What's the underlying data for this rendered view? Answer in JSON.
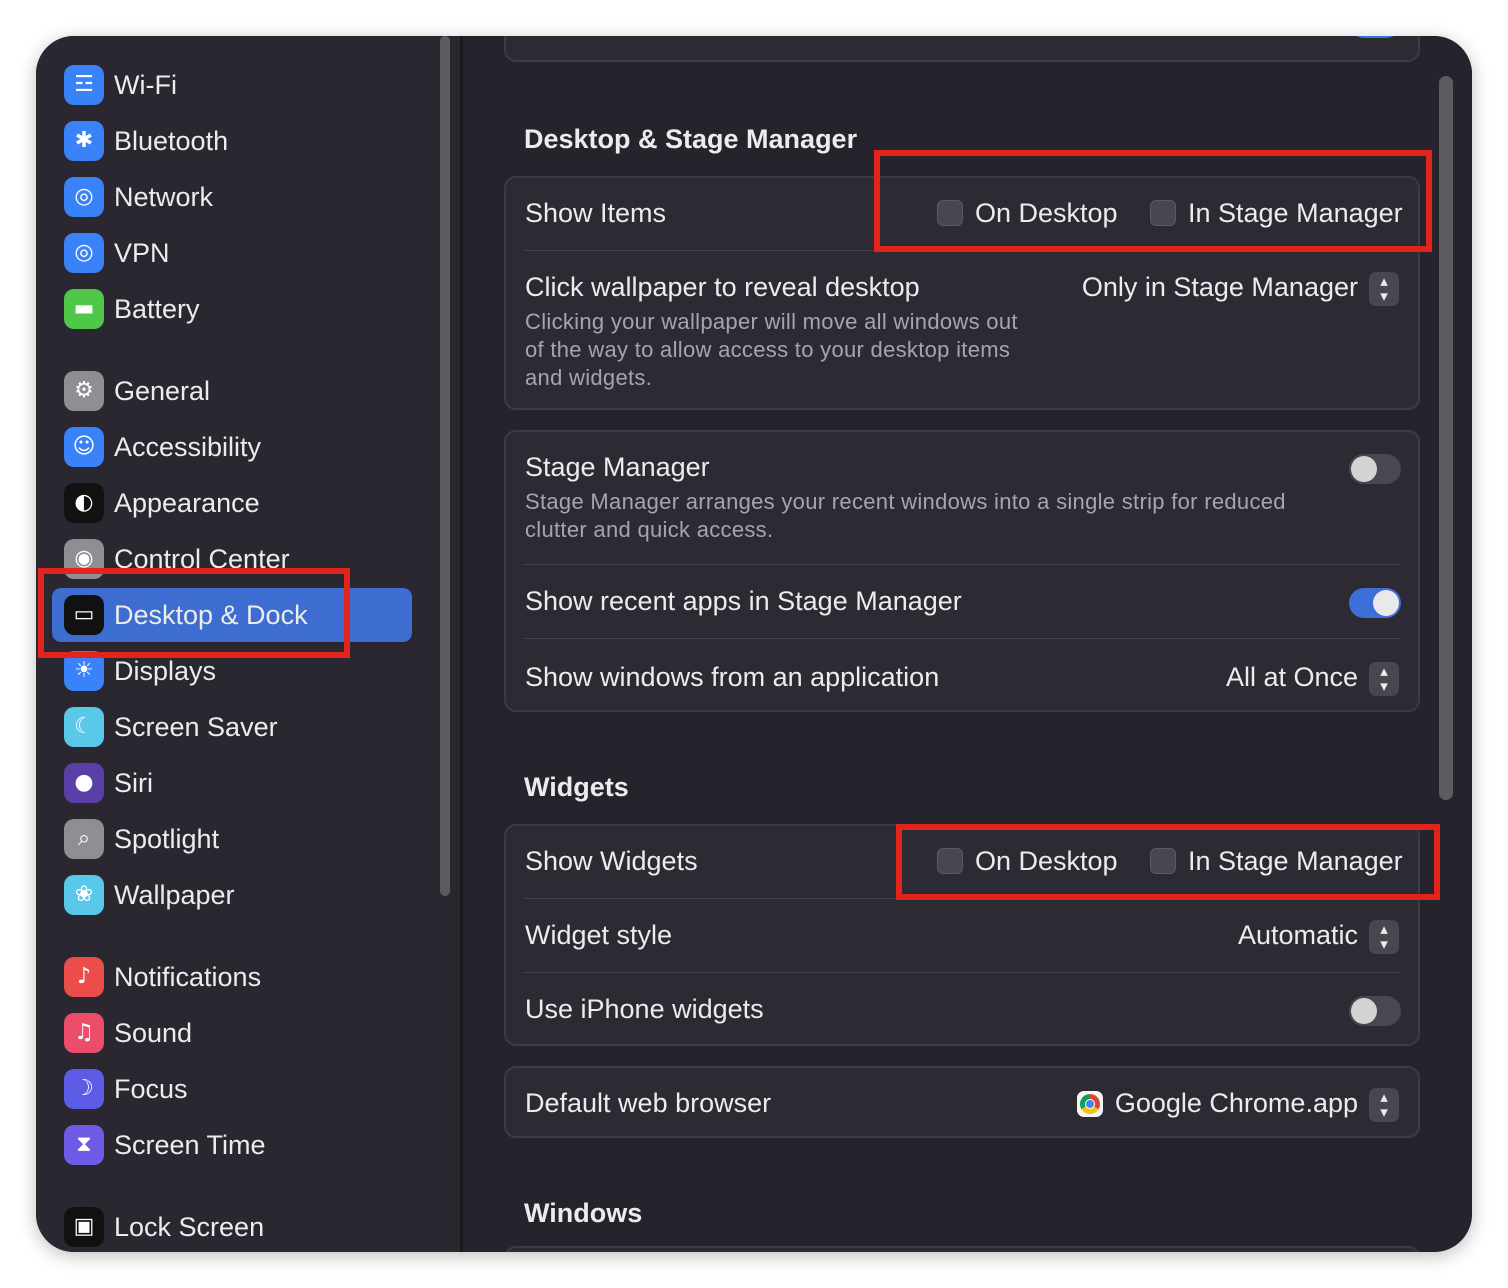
{
  "sidebar": {
    "items": [
      {
        "label": "Wi-Fi",
        "icon": "wifi-icon",
        "glyph": "☲",
        "color": "#3a82f7"
      },
      {
        "label": "Bluetooth",
        "icon": "bluetooth-icon",
        "glyph": "✱",
        "color": "#3a82f7"
      },
      {
        "label": "Network",
        "icon": "globe-icon",
        "glyph": "◎",
        "color": "#3a82f7"
      },
      {
        "label": "VPN",
        "icon": "vpn-globe-icon",
        "glyph": "◎",
        "color": "#3a82f7"
      },
      {
        "label": "Battery",
        "icon": "battery-icon",
        "glyph": "▬",
        "color": "#4fc84a"
      },
      {
        "label": "General",
        "icon": "gear-icon",
        "glyph": "⚙",
        "color": "#8e8e93"
      },
      {
        "label": "Accessibility",
        "icon": "accessibility-icon",
        "glyph": "☺",
        "color": "#3a82f7"
      },
      {
        "label": "Appearance",
        "icon": "appearance-icon",
        "glyph": "◐",
        "color": "#111111"
      },
      {
        "label": "Control Center",
        "icon": "control-center-icon",
        "glyph": "◉",
        "color": "#8e8e93"
      },
      {
        "label": "Desktop & Dock",
        "icon": "dock-icon",
        "glyph": "▭",
        "color": "#111111"
      },
      {
        "label": "Displays",
        "icon": "sun-icon",
        "glyph": "☀",
        "color": "#3a82f7"
      },
      {
        "label": "Screen Saver",
        "icon": "screen-saver-icon",
        "glyph": "☾",
        "color": "#5ac8e8"
      },
      {
        "label": "Siri",
        "icon": "siri-icon",
        "glyph": "●",
        "color": "#5b3fa8"
      },
      {
        "label": "Spotlight",
        "icon": "search-icon",
        "glyph": "⌕",
        "color": "#8e8e93"
      },
      {
        "label": "Wallpaper",
        "icon": "flower-icon",
        "glyph": "❀",
        "color": "#5ac8e8"
      },
      {
        "label": "Notifications",
        "icon": "bell-icon",
        "glyph": "♪",
        "color": "#eb4d4b"
      },
      {
        "label": "Sound",
        "icon": "speaker-icon",
        "glyph": "♫",
        "color": "#eb4d6b"
      },
      {
        "label": "Focus",
        "icon": "moon-icon",
        "glyph": "☽",
        "color": "#5d5ce6"
      },
      {
        "label": "Screen Time",
        "icon": "hourglass-icon",
        "glyph": "⧗",
        "color": "#6e5ce6"
      },
      {
        "label": "Lock Screen",
        "icon": "lock-icon",
        "glyph": "▣",
        "color": "#111111"
      }
    ],
    "selected": "Desktop & Dock"
  },
  "sections": {
    "desktop_stage_title": "Desktop & Stage Manager",
    "widgets_title": "Widgets",
    "windows_title": "Windows"
  },
  "show_items": {
    "label": "Show Items",
    "on_desktop": "On Desktop",
    "in_stage_manager": "In Stage Manager"
  },
  "click_wallpaper": {
    "label": "Click wallpaper to reveal desktop",
    "desc1": "Clicking your wallpaper will move all windows out",
    "desc2": "of the way to allow access to your desktop items",
    "desc3": "and widgets.",
    "value": "Only in Stage Manager"
  },
  "stage_manager": {
    "label": "Stage Manager",
    "desc1": "Stage Manager arranges your recent windows into a single strip for reduced",
    "desc2": "clutter and quick access.",
    "enabled": false
  },
  "show_recent_apps": {
    "label": "Show recent apps in Stage Manager",
    "enabled": true
  },
  "show_windows": {
    "label": "Show windows from an application",
    "value": "All at Once"
  },
  "show_widgets": {
    "label": "Show Widgets",
    "on_desktop": "On Desktop",
    "in_stage_manager": "In Stage Manager"
  },
  "widget_style": {
    "label": "Widget style",
    "value": "Automatic"
  },
  "iphone_widgets": {
    "label": "Use iPhone widgets",
    "enabled": false
  },
  "default_browser": {
    "label": "Default web browser",
    "value": "Google Chrome.app"
  },
  "colors": {
    "accent": "#3d6dd0",
    "annotation": "#e2241c"
  }
}
